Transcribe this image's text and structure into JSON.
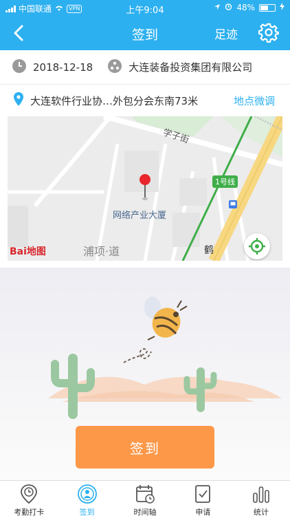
{
  "status": {
    "carrier": "中国联通",
    "vpn": "VPN",
    "time": "上午9:04",
    "battery": "48%"
  },
  "nav": {
    "title": "签到",
    "footprint": "足迹"
  },
  "info": {
    "date": "2018-12-18",
    "company": "大连装备投资集团有限公司"
  },
  "location": {
    "address": "大连软件行业协…外包分会东南73米",
    "adjust": "地点微调"
  },
  "map": {
    "street1": "学子街",
    "metro": "1号线",
    "building": "网络产业大厦",
    "district": "浦项·道",
    "road_char": "鹤",
    "logo": "Bai地图"
  },
  "sign_button": "签到",
  "tabs": [
    {
      "label": "考勤打卡",
      "icon": "clock-pin-icon",
      "active": false
    },
    {
      "label": "签到",
      "icon": "person-pin-icon",
      "active": true
    },
    {
      "label": "时间轴",
      "icon": "calendar-clock-icon",
      "active": false
    },
    {
      "label": "申请",
      "icon": "checklist-icon",
      "active": false
    },
    {
      "label": "统计",
      "icon": "bar-chart-icon",
      "active": false
    }
  ],
  "colors": {
    "brand": "#2db0f0",
    "button": "#fd9849"
  }
}
